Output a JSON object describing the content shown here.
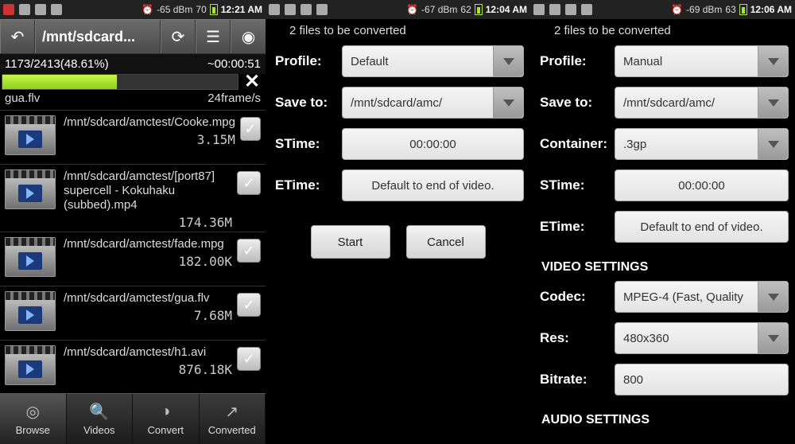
{
  "pane1": {
    "status": {
      "signal": "-65 dBm",
      "batt": "70",
      "time": "12:21 AM"
    },
    "path": "/mnt/sdcard...",
    "progress": {
      "text": "1173/2413(48.61%)",
      "eta": "~00:00:51",
      "pct": 48.61
    },
    "current": {
      "file": "gua.flv",
      "rate": "24frame/s"
    },
    "files": [
      {
        "path": "/mnt/sdcard/amctest/Cooke.mpg",
        "size": "3.15M"
      },
      {
        "path": "/mnt/sdcard/amctest/[port87] supercell - Kokuhaku (subbed).mp4",
        "size": "174.36M"
      },
      {
        "path": "/mnt/sdcard/amctest/fade.mpg",
        "size": "182.00K"
      },
      {
        "path": "/mnt/sdcard/amctest/gua.flv",
        "size": "7.68M"
      },
      {
        "path": "/mnt/sdcard/amctest/h1.avi",
        "size": "876.18K"
      }
    ],
    "nav": {
      "browse": "Browse",
      "videos": "Videos",
      "convert": "Convert",
      "converted": "Converted"
    }
  },
  "pane2": {
    "status": {
      "signal": "-67 dBm",
      "batt": "62",
      "time": "12:04 AM"
    },
    "count": "2  files to be converted",
    "labels": {
      "profile": "Profile:",
      "saveto": "Save to:",
      "stime": "STime:",
      "etime": "ETime:"
    },
    "values": {
      "profile": "Default",
      "saveto": "/mnt/sdcard/amc/",
      "stime": "00:00:00",
      "etime": "Default to end of video."
    },
    "buttons": {
      "start": "Start",
      "cancel": "Cancel"
    }
  },
  "pane3": {
    "status": {
      "signal": "-69 dBm",
      "batt": "63",
      "time": "12:06 AM"
    },
    "count": "2  files to be converted",
    "labels": {
      "profile": "Profile:",
      "saveto": "Save to:",
      "container": "Container:",
      "stime": "STime:",
      "etime": "ETime:",
      "videohdr": "VIDEO SETTINGS",
      "codec": "Codec:",
      "res": "Res:",
      "bitrate": "Bitrate:",
      "audiohdr": "AUDIO SETTINGS"
    },
    "values": {
      "profile": "Manual",
      "saveto": "/mnt/sdcard/amc/",
      "container": ".3gp",
      "stime": "00:00:00",
      "etime": "Default to end of video.",
      "codec": "MPEG-4 (Fast, Quality",
      "res": "480x360",
      "bitrate": "800"
    }
  }
}
